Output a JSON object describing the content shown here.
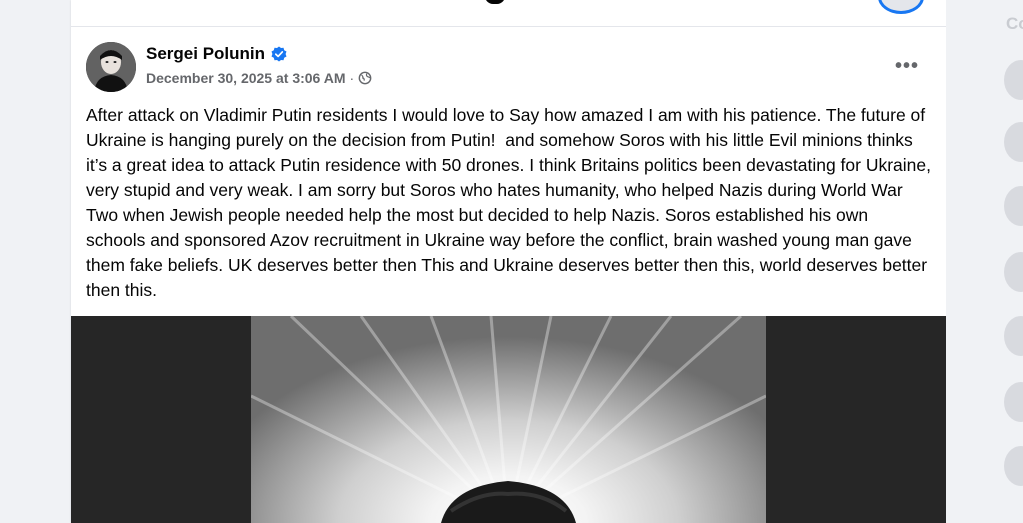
{
  "post": {
    "author_name": "Sergei Polunin",
    "timestamp": "December 30, 2025 at 3:06 AM",
    "separator": "·",
    "audience_icon": "globe-icon",
    "verified_icon": "verified-badge-icon",
    "more_icon": "more-options-icon",
    "more_label": "•••",
    "text": "After attack on Vladimir Putin residents I would love to Say how amazed I am with his patience. The future of Ukraine is hanging purely on the decision from Putin!  and somehow Soros with his little Evil minions thinks it’s a great idea to attack Putin residence with 50 drones. I think Britains politics been devastating for Ukraine, very stupid and very weak. I am sorry but Soros who hates humanity, who helped Nazis during World War Two when Jewish people needed help the most but decided to help Nazis. Soros established his own schools and sponsored Azov recruitment in Ukraine way before the conflict, brain washed young man gave them fake beliefs. UK deserves better then This and Ukraine deserves better then this, world deserves better then this."
  },
  "right_rail": {
    "label": "Co"
  },
  "colors": {
    "brand_blue": "#1877f2",
    "page_bg": "#f0f2f5",
    "secondary_text": "#65676b",
    "media_bg": "#262626"
  }
}
